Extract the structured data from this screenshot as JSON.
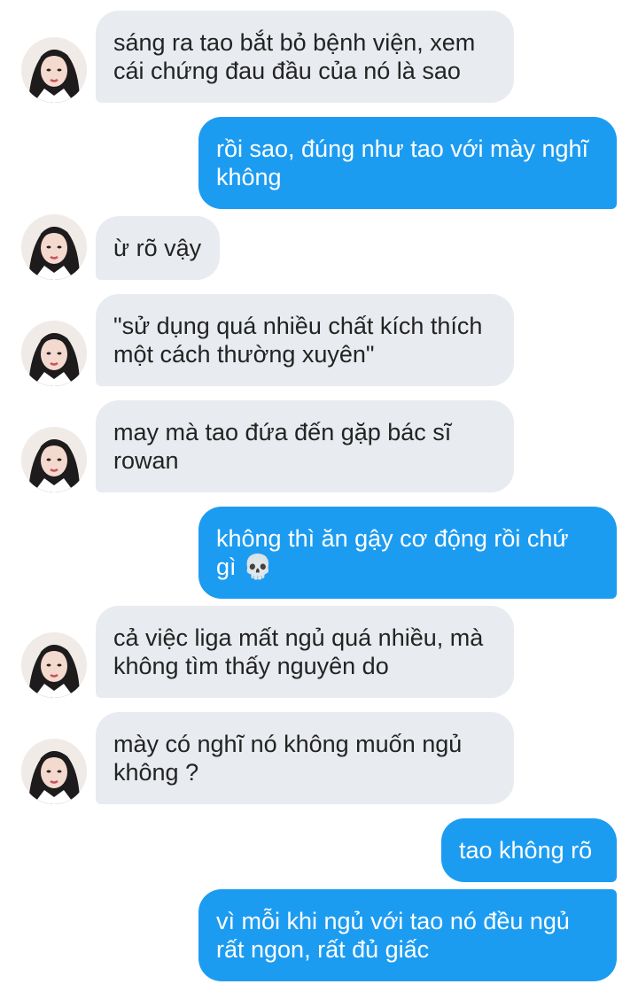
{
  "conversation": {
    "messages": [
      {
        "sender": "other",
        "text": "sáng ra tao bắt bỏ bệnh viện, xem\ncái chứng đau đầu của nó là sao"
      },
      {
        "sender": "me",
        "text": "rồi sao, đúng như tao với mày nghĩ\nkhông"
      },
      {
        "sender": "other",
        "text": "ừ rõ vậy"
      },
      {
        "sender": "other",
        "text": "\"sử dụng quá nhiều chất kích thích\nmột cách thường xuyên\""
      },
      {
        "sender": "other",
        "text": "may mà tao đứa đến gặp bác sĩ\nrowan"
      },
      {
        "sender": "me",
        "text": "không thì ăn gậy cơ động rồi chứ\ngì 💀"
      },
      {
        "sender": "other",
        "text": "cả việc liga mất ngủ quá nhiều, mà\nkhông tìm thấy nguyên do"
      },
      {
        "sender": "other",
        "text": "mày có nghĩ nó không muốn ngủ\nkhông ?"
      },
      {
        "sender": "me",
        "text": "tao không rõ"
      },
      {
        "sender": "me",
        "text": "vì mỗi khi ngủ với tao nó đều ngủ\nrất ngon, rất đủ giấc"
      }
    ]
  },
  "colors": {
    "incoming_bubble": "#e8ebef",
    "outgoing_bubble": "#1c9cf1",
    "incoming_text": "#232323",
    "outgoing_text": "#ffffff"
  },
  "icons": {
    "avatar": "profile-photo-avatar",
    "emoji": "skull-emoji"
  }
}
